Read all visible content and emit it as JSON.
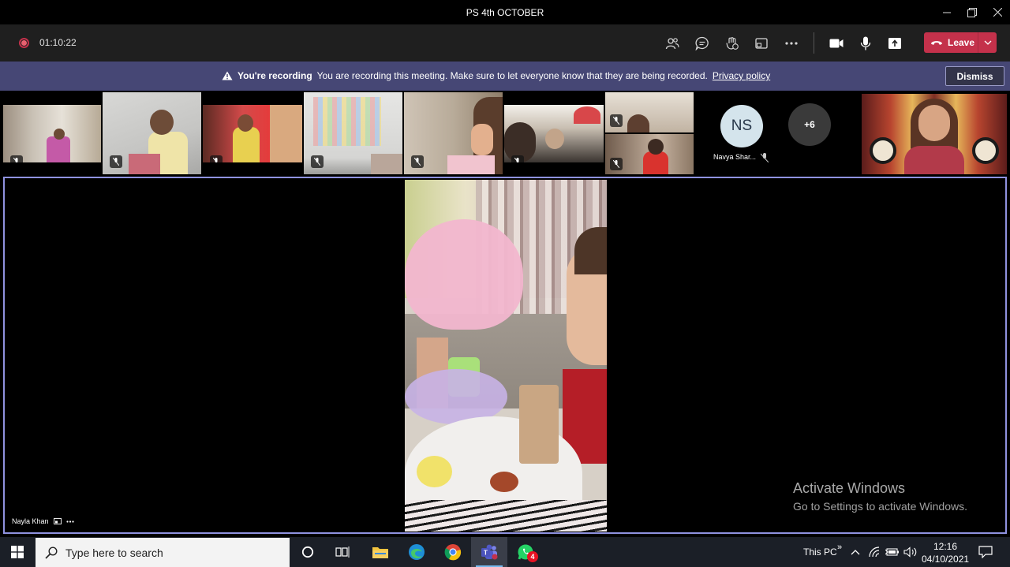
{
  "window": {
    "title": "PS 4th OCTOBER",
    "minimize_icon": "minimize-icon",
    "restore_icon": "restore-icon",
    "close_icon": "close-icon"
  },
  "toolbar": {
    "recording_indicator": "recording-dot-icon",
    "timer": "01:10:22",
    "icons": [
      "people-icon",
      "chat-icon",
      "reactions-icon",
      "breakout-rooms-icon",
      "more-options-icon",
      "camera-icon",
      "microphone-icon",
      "share-icon"
    ],
    "leave_label": "Leave",
    "accent_color": "#c4314b"
  },
  "banner": {
    "title": "You're recording",
    "message": "You are recording this meeting. Make sure to let everyone know that they are being recorded.",
    "link": "Privacy policy",
    "dismiss_label": "Dismiss",
    "background": "#464775"
  },
  "gallery": {
    "participants": [
      {
        "type": "video",
        "muted": true
      },
      {
        "type": "video",
        "muted": true
      },
      {
        "type": "video",
        "muted": true
      },
      {
        "type": "video",
        "muted": true
      },
      {
        "type": "video",
        "muted": true
      },
      {
        "type": "video",
        "muted": true
      },
      {
        "type": "video",
        "muted": true
      },
      {
        "type": "video",
        "muted": true
      }
    ],
    "avatar_initials": "NS",
    "avatar_name": "Navya Shar...",
    "overflow_count": "+6"
  },
  "stage": {
    "presenter_name": "Nayla Khan",
    "border_color": "#8f92e0"
  },
  "watermark": {
    "line1": "Activate Windows",
    "line2": "Go to Settings to activate Windows."
  },
  "taskbar": {
    "search_placeholder": "Type here to search",
    "apps": [
      "cortana-icon",
      "task-view-icon",
      "file-explorer-icon",
      "edge-icon",
      "chrome-icon",
      "teams-icon",
      "whatsapp-icon"
    ],
    "whatsapp_badge": "4",
    "this_pc": "This PC",
    "time": "12:16",
    "date": "04/10/2021"
  }
}
